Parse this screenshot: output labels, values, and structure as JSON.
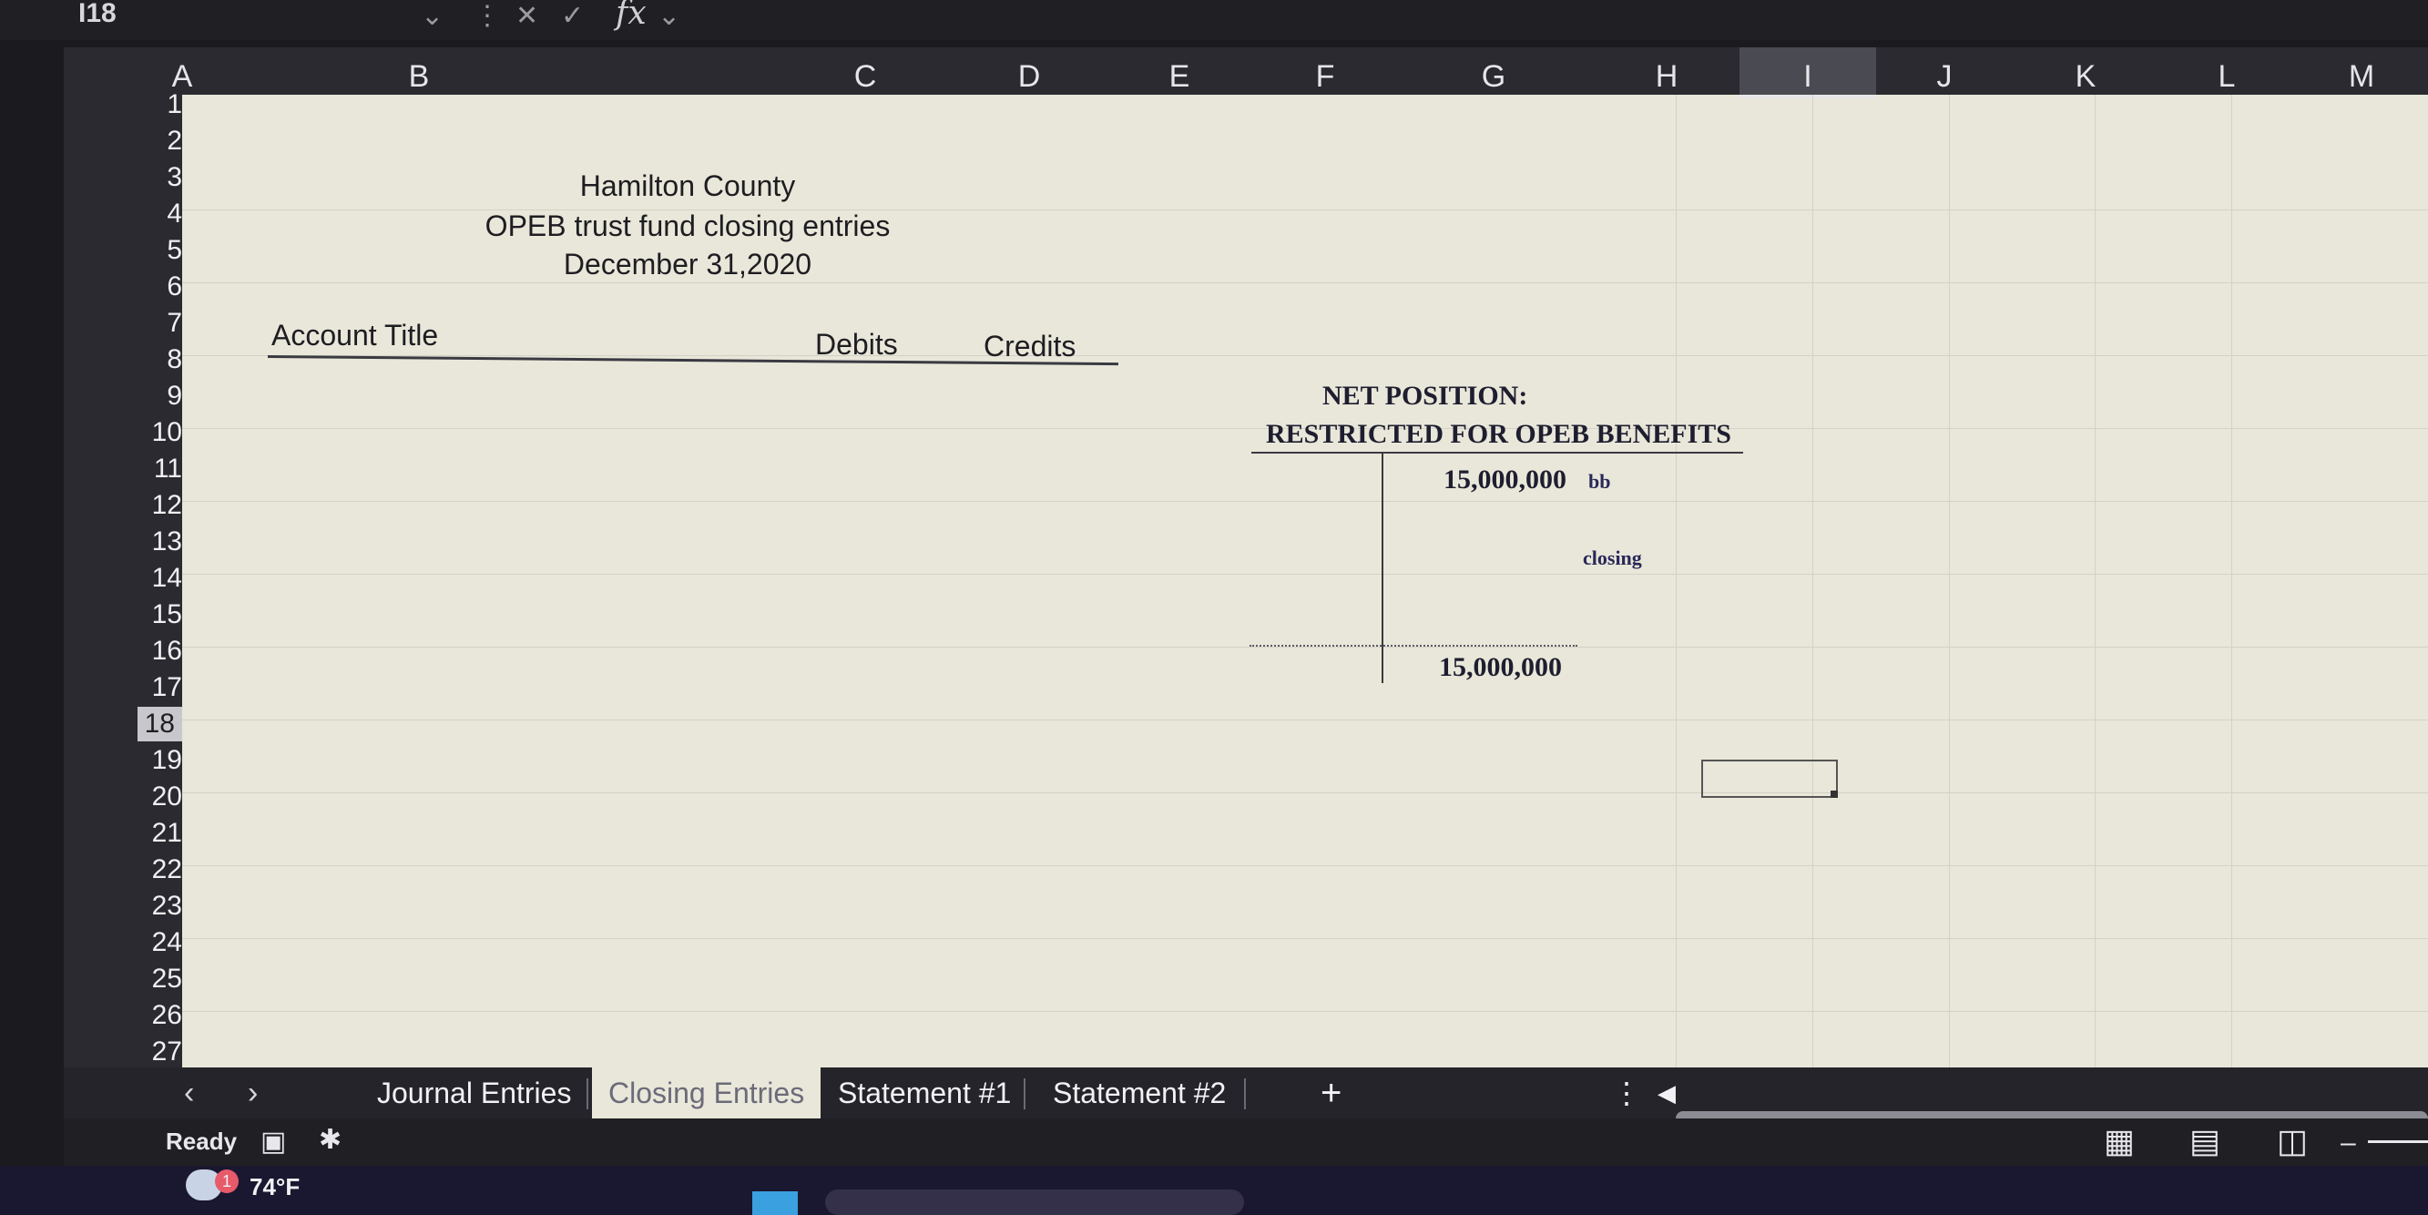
{
  "formula_bar": {
    "name_box": "I18",
    "fx_label": "fx"
  },
  "columns": [
    "A",
    "B",
    "C",
    "D",
    "E",
    "F",
    "G",
    "H",
    "I",
    "J",
    "K",
    "L",
    "M"
  ],
  "rows": [
    "1",
    "2",
    "3",
    "4",
    "5",
    "6",
    "7",
    "8",
    "9",
    "10",
    "11",
    "12",
    "13",
    "14",
    "15",
    "16",
    "17",
    "18",
    "19",
    "20",
    "21",
    "22",
    "23",
    "24",
    "25",
    "26",
    "27"
  ],
  "selected_column": "I",
  "selected_row": "18",
  "sheet": {
    "title_line1": "Hamilton County",
    "title_line2": "OPEB trust fund closing entries",
    "title_line3": "December 31,2020",
    "account_title_header": "Account Title",
    "debits_header": "Debits",
    "credits_header": "Credits",
    "t_account_title1": "NET POSITION:",
    "t_account_title2": "RESTRICTED FOR OPEB BENEFITS",
    "t_account_balance": "15,000,000",
    "t_account_bb": "bb",
    "t_account_closing": "closing",
    "t_account_total": "15,000,000"
  },
  "tabs": [
    {
      "label": "Journal Entries",
      "active": false
    },
    {
      "label": "Closing Entries",
      "active": true
    },
    {
      "label": "Statement #1",
      "active": false
    },
    {
      "label": "Statement #2",
      "active": false
    }
  ],
  "add_sheet_label": "+",
  "status": {
    "ready": "Ready"
  },
  "taskbar": {
    "temperature": "74°F",
    "weather_badge": "1"
  }
}
